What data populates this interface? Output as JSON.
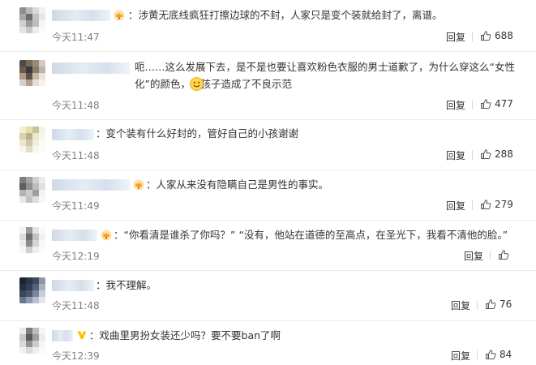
{
  "comments": [
    {
      "text": "涉黄无底线疯狂打擦边球的不封，人家只是变个装就给封了，离谱。",
      "time": "今天11:47",
      "reply_label": "回复",
      "likes": "688",
      "badge": "crown-badge"
    },
    {
      "text": "呃……这么发展下去，是不是也要让喜欢粉色衣服的男士道歉了，为什么穿这么“女性化”的颜色，给孩子造成了不良示范",
      "time": "今天11:48",
      "reply_label": "回复",
      "likes": "477",
      "emoji": "smile-emoji"
    },
    {
      "text": "变个装有什么好封的，管好自己的小孩谢谢",
      "time": "今天11:48",
      "reply_label": "回复",
      "likes": "288"
    },
    {
      "text": "人家从来没有隐瞒自己是男性的事实。",
      "time": "今天11:49",
      "reply_label": "回复",
      "likes": "279",
      "badge": "crown-badge"
    },
    {
      "text": "“你看清是谁杀了你吗？” “没有，他站在道德的至高点，在圣光下，我看不清他的脸。”",
      "time": "今天12:19",
      "reply_label": "回复",
      "likes": "",
      "badge": "crown-badge"
    },
    {
      "text": "我不理解。",
      "time": "今天11:48",
      "reply_label": "回复",
      "likes": "76"
    },
    {
      "text": "戏曲里男扮女装还少吗？要不要ban了啊",
      "time": "今天12:39",
      "reply_label": "回复",
      "likes": "84",
      "badge": "verified-v-badge"
    }
  ],
  "colors": {
    "text": "#333333",
    "time": "#808080",
    "divider": "#ececec",
    "crown": "#f5a623",
    "verified": "#ffc000"
  }
}
